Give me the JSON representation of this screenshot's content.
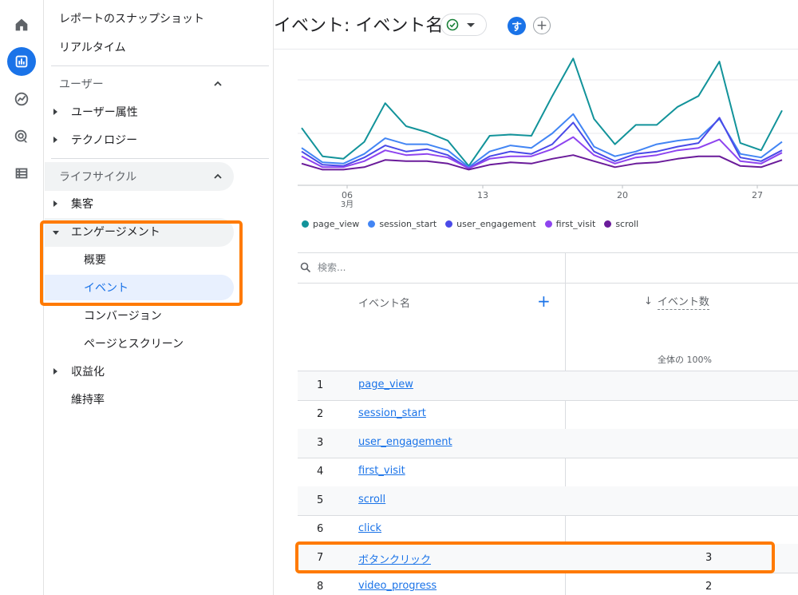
{
  "rail": {
    "items": [
      {
        "icon": "home-icon"
      },
      {
        "icon": "reports-icon",
        "active": true
      },
      {
        "icon": "explore-icon"
      },
      {
        "icon": "advertising-icon"
      },
      {
        "icon": "configure-icon"
      }
    ]
  },
  "nav": {
    "snapshot": "レポートのスナップショット",
    "realtime": "リアルタイム",
    "user_section": "ユーザー",
    "user_attr": "ユーザー属性",
    "technology": "テクノロジー",
    "lifecycle_section": "ライフサイクル",
    "acquisition": "集客",
    "engagement": "エンゲージメント",
    "overview": "概要",
    "events": "イベント",
    "conversions": "コンバージョン",
    "pages_screens": "ページとスクリーン",
    "monetization": "収益化",
    "retention": "維持率"
  },
  "header": {
    "title": "イベント: イベント名",
    "avatar_letter": "す",
    "add_symbol": "+"
  },
  "chart_data": {
    "type": "line",
    "x_tick_labels": [
      "06",
      "13",
      "20",
      "27"
    ],
    "x_sublabel": "3月",
    "series": [
      {
        "name": "page_view",
        "color": "#12939a",
        "values": [
          95,
          48,
          44,
          72,
          136,
          98,
          88,
          74,
          32,
          82,
          84,
          82,
          148,
          210,
          110,
          68,
          100,
          100,
          130,
          148,
          205,
          70,
          58,
          124
        ]
      },
      {
        "name": "session_start",
        "color": "#4285f4",
        "values": [
          62,
          38,
          36,
          52,
          78,
          68,
          68,
          58,
          30,
          56,
          66,
          62,
          86,
          118,
          64,
          48,
          56,
          68,
          74,
          78,
          110,
          52,
          46,
          72
        ]
      },
      {
        "name": "user_engagement",
        "color": "#4a4ae8",
        "values": [
          56,
          34,
          32,
          46,
          66,
          56,
          60,
          50,
          28,
          48,
          56,
          52,
          68,
          104,
          56,
          40,
          52,
          56,
          64,
          70,
          112,
          46,
          40,
          58
        ]
      },
      {
        "name": "first_visit",
        "color": "#8e44ef",
        "values": [
          48,
          30,
          30,
          40,
          58,
          50,
          52,
          46,
          28,
          44,
          48,
          48,
          60,
          80,
          50,
          36,
          46,
          50,
          58,
          62,
          76,
          40,
          36,
          54
        ]
      },
      {
        "name": "scroll",
        "color": "#6a1b9a",
        "values": [
          36,
          26,
          26,
          30,
          42,
          40,
          40,
          36,
          26,
          34,
          38,
          36,
          44,
          50,
          40,
          30,
          36,
          38,
          44,
          48,
          48,
          32,
          30,
          42
        ]
      }
    ],
    "ylim": [
      0,
      225
    ],
    "grid": true,
    "legend_position": "bottom"
  },
  "table": {
    "search_placeholder": "検索...",
    "col_name": "イベント名",
    "col_add": "+",
    "sort_arrow": "↓",
    "col_count": "イベント数",
    "col_count_sub": "全体の 100%",
    "rows": [
      {
        "num": "1",
        "name": "page_view",
        "count": ""
      },
      {
        "num": "2",
        "name": "session_start",
        "count": ""
      },
      {
        "num": "3",
        "name": "user_engagement",
        "count": ""
      },
      {
        "num": "4",
        "name": "first_visit",
        "count": ""
      },
      {
        "num": "5",
        "name": "scroll",
        "count": ""
      },
      {
        "num": "6",
        "name": "click",
        "count": ""
      },
      {
        "num": "7",
        "name": "ボタンクリック",
        "count": "3"
      },
      {
        "num": "8",
        "name": "video_progress",
        "count": "2"
      }
    ]
  },
  "colors": {
    "accent": "#1a73e8",
    "highlight": "#ff7a00",
    "active_nav_bg": "#e8f0fe"
  }
}
